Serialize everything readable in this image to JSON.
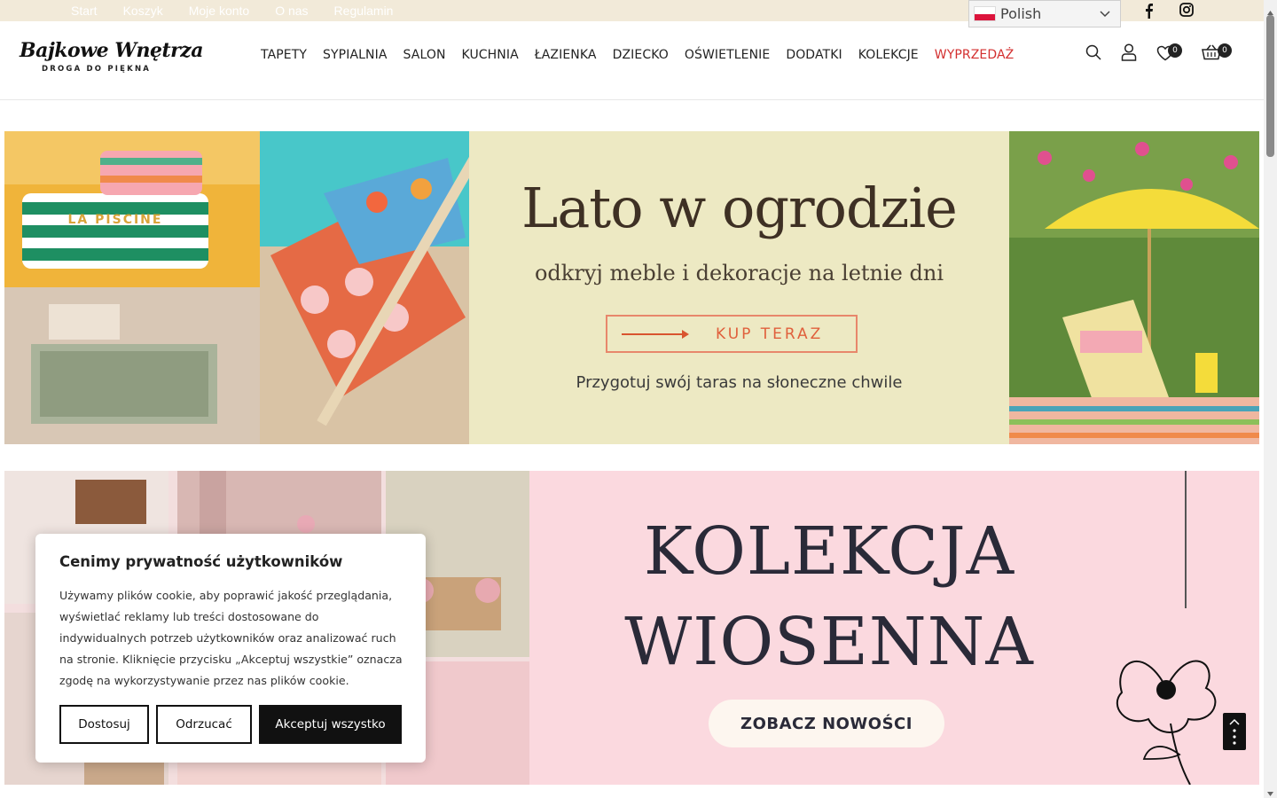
{
  "topbar": {
    "links": [
      "Start",
      "Koszyk",
      "Moje konto",
      "O nas",
      "Regulamin"
    ],
    "language": "Polish",
    "social": [
      "facebook-icon",
      "instagram-icon"
    ]
  },
  "header": {
    "logo_name": "Bajkowe Wnętrza",
    "logo_tagline": "DROGA DO PIĘKNA",
    "nav": [
      "TAPETY",
      "SYPIALNIA",
      "SALON",
      "KUCHNIA",
      "ŁAZIENKA",
      "DZIECKO",
      "OŚWIETLENIE",
      "DODATKI",
      "KOLEKCJE",
      "WYPRZEDAŻ"
    ],
    "icons": [
      "search-icon",
      "user-icon",
      "heart-icon",
      "basket-icon"
    ],
    "wishlist_count": "0",
    "cart_count": "0"
  },
  "banner1": {
    "title": "Lato w ogrodzie",
    "subtitle": "odkryj meble i dekoracje na letnie dni",
    "button": "KUP TERAZ",
    "note": "Przygotuj swój taras na słoneczne chwile",
    "photo_text": "LA PISCINE"
  },
  "banner2": {
    "title_line1": "KOLEKCJA",
    "title_line2": "WIOSENNA",
    "button": "ZOBACZ NOWOŚCI"
  },
  "cookie": {
    "title": "Cenimy prywatność użytkowników",
    "text": "Używamy plików cookie, aby poprawić jakość przeglądania, wyświetlać reklamy lub treści dostosowane do indywidualnych potrzeb użytkowników oraz analizować ruch na stronie. Kliknięcie przycisku „Akceptuj wszystkie” oznacza zgodę na wykorzystywanie przez nas plików cookie.",
    "btn_customize": "Dostosuj",
    "btn_reject": "Odrzucać",
    "btn_accept": "Akceptuj wszystko"
  },
  "colors": {
    "topbar_bg": "#f2ead9",
    "sale_red": "#d32f2f",
    "banner1_bg": "#ede9c3",
    "banner1_accent": "#e0603c",
    "banner2_bg": "#fbd9df",
    "dark": "#111111"
  }
}
